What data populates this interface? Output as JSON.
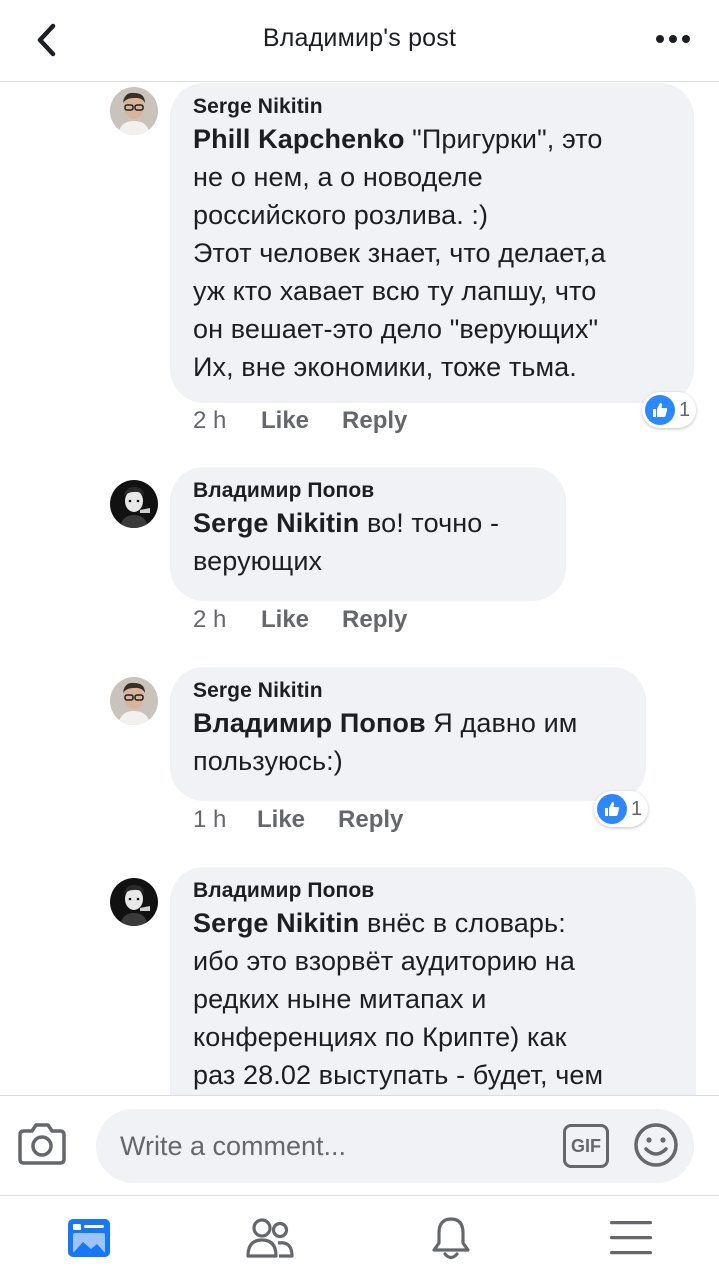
{
  "header": {
    "title": "Владимир's post"
  },
  "comments": [
    {
      "author": "Serge Nikitin",
      "mention": "Phill Kapchenko",
      "text_first": " \"Пригурки\", это",
      "lines": [
        "не о нем, а о новоделе",
        "российского розлива. :)",
        "Этот человек знает, что делает,а",
        "уж кто хавает всю ту лапшу, что",
        "он вешает-это дело \"верующих\"",
        "Их, вне экономики, тоже тьма."
      ],
      "time": "2 h",
      "like": "Like",
      "reply": "Reply",
      "reactions": "1"
    },
    {
      "author": "Владимир Попов",
      "mention": "Serge Nikitin",
      "text_first": " во! точно -",
      "lines": [
        "верующих"
      ],
      "time": "2 h",
      "like": "Like",
      "reply": "Reply"
    },
    {
      "author": "Serge Nikitin",
      "mention": "Владимир Попов",
      "text_first": " Я давно им",
      "lines": [
        "пользуюсь:)"
      ],
      "time": "1 h",
      "like": "Like",
      "reply": "Reply",
      "reactions": "1"
    },
    {
      "author": "Владимир Попов",
      "mention": "Serge Nikitin",
      "text_first": " внёс в словарь:",
      "lines": [
        "ибо это взорвёт аудиторию на",
        "редких ныне митапах  и",
        "конференциях по Крипте) как",
        "раз 28.02 выступать - будет, чем"
      ]
    }
  ],
  "composer": {
    "placeholder": "Write a comment...",
    "gif_label": "GIF"
  },
  "icons": {
    "back": "chevron-left-icon",
    "more": "more-horizontal-icon",
    "camera": "camera-icon",
    "emoji": "emoji-smile-icon",
    "like": "thumbs-up-icon",
    "news_feed": "news-feed-icon",
    "friends": "friends-icon",
    "notifications": "bell-icon",
    "menu": "hamburger-menu-icon"
  },
  "colors": {
    "like_blue": "#2d88ff",
    "tab_active": "#1877f2",
    "bubble_bg": "#f0f2f5",
    "secondary_text": "#65676b"
  }
}
